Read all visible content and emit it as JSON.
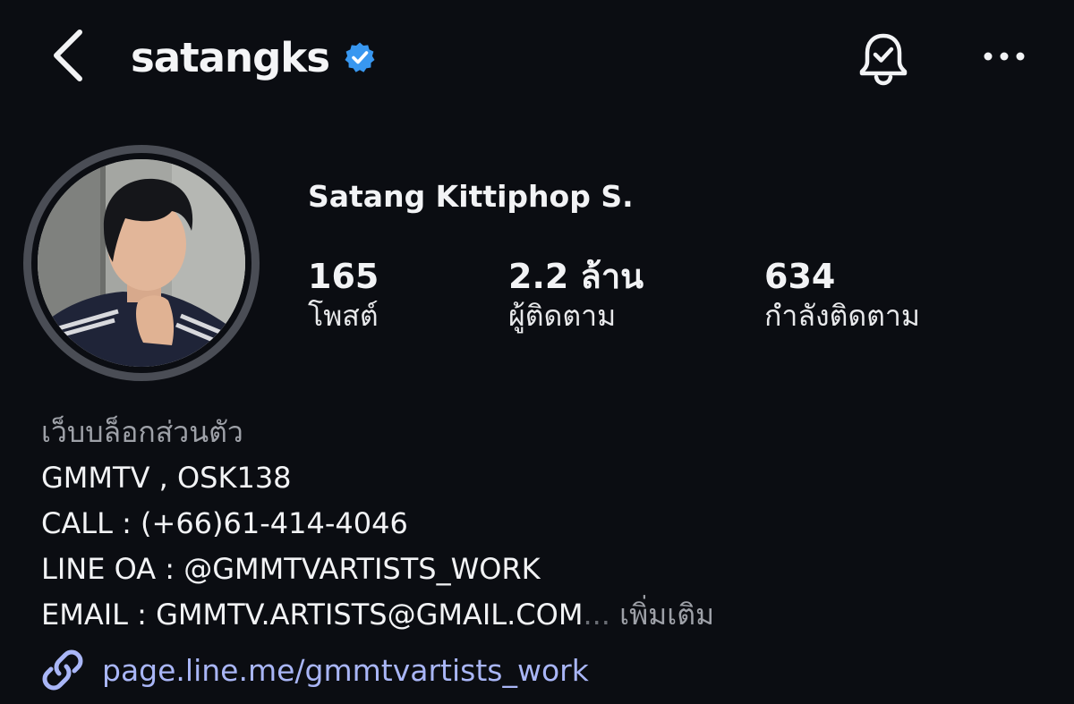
{
  "header": {
    "username": "satangks",
    "verified": true,
    "back_icon": "chevron-left-icon",
    "bell_icon": "bell-check-icon",
    "more_icon": "ellipsis-horizontal-icon",
    "verified_color": "#3897f0"
  },
  "profile": {
    "avatar_alt": "profile picture",
    "display_name": "Satang Kittiphop S.",
    "stats": [
      {
        "value": "165",
        "label": "โพสต์"
      },
      {
        "value": "2.2 ล้าน",
        "label": "ผู้ติดตาม"
      },
      {
        "value": "634",
        "label": "กำลังติดตาม"
      }
    ]
  },
  "bio": {
    "category": "เว็บบล็อกส่วนตัว",
    "lines": [
      "GMMTV , OSK138",
      "CALL : (+66)61-414-4046",
      "LINE OA : @GMMTVARTISTS_WORK",
      "EMAIL : GMMTV.ARTISTS@GMAIL.COM"
    ],
    "ellipsis": "...",
    "more": " เพิ่มเติม"
  },
  "link": {
    "icon": "link-icon",
    "text": "page.line.me/gmmtvartists_work",
    "color": "#a9b6f7"
  }
}
